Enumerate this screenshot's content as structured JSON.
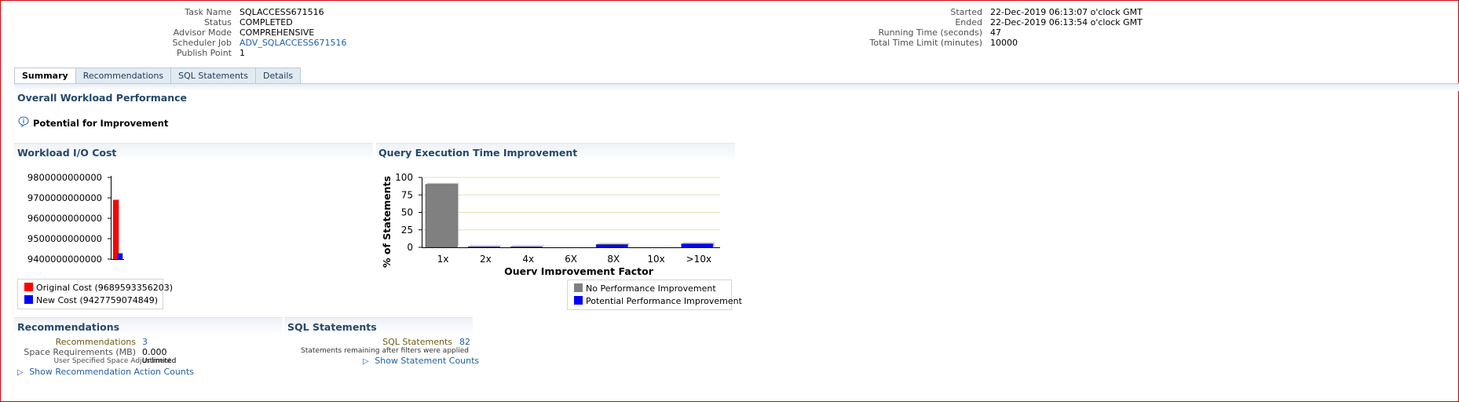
{
  "task_info": {
    "left": [
      {
        "label": "Task Name",
        "value": "SQLACCESS671516",
        "link": false
      },
      {
        "label": "Status",
        "value": "COMPLETED",
        "link": false
      },
      {
        "label": "Advisor Mode",
        "value": "COMPREHENSIVE",
        "link": false
      },
      {
        "label": "Scheduler Job",
        "value": "ADV_SQLACCESS671516",
        "link": true
      },
      {
        "label": "Publish Point",
        "value": "1",
        "link": false
      }
    ],
    "right": [
      {
        "label": "Started",
        "value": "22-Dec-2019 06:13:07 o'clock GMT"
      },
      {
        "label": "Ended",
        "value": "22-Dec-2019 06:13:54 o'clock GMT"
      },
      {
        "label": "Running Time (seconds)",
        "value": "47"
      },
      {
        "label": "Total Time Limit (minutes)",
        "value": "10000"
      }
    ]
  },
  "tabs": [
    {
      "label": "Summary",
      "active": true
    },
    {
      "label": "Recommendations",
      "active": false
    },
    {
      "label": "SQL Statements",
      "active": false
    },
    {
      "label": "Details",
      "active": false
    }
  ],
  "overall": {
    "title": "Overall Workload Performance",
    "potential_label": "Potential for Improvement",
    "info_icon": "info-icon"
  },
  "io_cost": {
    "title": "Workload I/O Cost",
    "legend": [
      "Original Cost (9689593356203)",
      "New Cost (9427759074849)"
    ]
  },
  "qet": {
    "title": "Query Execution Time Improvement",
    "legend": [
      "No Performance Improvement",
      "Potential Performance Improvement"
    ]
  },
  "recommendations": {
    "title": "Recommendations",
    "rows": [
      {
        "label": "Recommendations",
        "value": "3",
        "link": true
      },
      {
        "label": "Space Requirements (MB)",
        "value": "0.000",
        "link": false
      },
      {
        "label": "User Specified Space Adjustment",
        "value": "Unlimited",
        "link": false
      }
    ],
    "show_link": "Show Recommendation Action Counts"
  },
  "sql_statements": {
    "title": "SQL Statements",
    "row_label": "SQL Statements",
    "row_value": "82",
    "note": "Statements remaining after filters were applied",
    "show_link": "Show Statement Counts"
  },
  "colors": {
    "original": "#ff0000",
    "new": "#0000ff",
    "no_improvement": "#808080",
    "potential": "#0000ff",
    "header_text": "#25476a"
  },
  "chart_data": [
    {
      "type": "bar",
      "title": "Workload I/O Cost",
      "categories": [
        "Original Cost",
        "New Cost"
      ],
      "series": [
        {
          "name": "Original Cost (9689593356203)",
          "values": [
            9689593356203
          ]
        },
        {
          "name": "New Cost (9427759074849)",
          "values": [
            9427759074849
          ]
        }
      ],
      "yticks": [
        "9800000000000",
        "9700000000000",
        "9600000000000",
        "9500000000000",
        "9400000000000"
      ],
      "ylim": [
        9400000000000,
        9800000000000
      ],
      "legend": "bottom"
    },
    {
      "type": "bar",
      "title": "Query Execution Time Improvement",
      "xlabel": "Query Improvement Factor",
      "ylabel": "% of Statements",
      "categories": [
        "1x",
        "2x",
        "4x",
        "6X",
        "8X",
        "10x",
        ">10x"
      ],
      "series": [
        {
          "name": "No Performance Improvement",
          "values": [
            90,
            0,
            0,
            0,
            0,
            0,
            0
          ]
        },
        {
          "name": "Potential Performance Improvement",
          "values": [
            0,
            1,
            1,
            0,
            4,
            0,
            5
          ]
        }
      ],
      "yticks": [
        "100",
        "75",
        "50",
        "25",
        "0"
      ],
      "ylim": [
        0,
        100
      ],
      "grid": true,
      "legend": "bottom-right"
    }
  ]
}
